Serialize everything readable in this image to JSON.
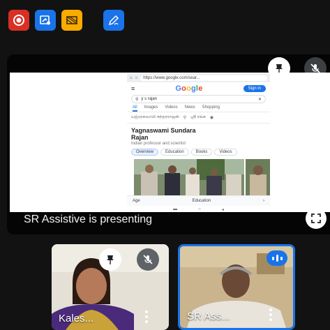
{
  "toolbar": {
    "buttons": [
      {
        "name": "record-icon",
        "color": "#d93025"
      },
      {
        "name": "whiteboard-share-icon",
        "color": "#1a73e8"
      },
      {
        "name": "no-video-icon",
        "color": "#f9ab00"
      },
      {
        "name": "annotate-pen-icon",
        "color": "#1a73e8"
      }
    ]
  },
  "stage": {
    "presenting_text": "SR Assistive is presenting",
    "shared_screen": {
      "url": "https://www.google.com/sear...",
      "logo": "Google",
      "signin": "Sign in",
      "query": "y s rajan",
      "tabs": [
        "All",
        "Images",
        "Videos",
        "News",
        "Shopping"
      ],
      "suggestion_left": "யஜ்ஞசுவாமி சுந்தரராஜன்",
      "suggestion_right": "ஸ்ரீ ரங்க",
      "kp_title": "Yagnaswami Sundara Rajan",
      "kp_subtitle": "Indian professor and scientist",
      "chips": [
        "Overview",
        "Education",
        "Books",
        "Videos"
      ],
      "row_left": "Age",
      "row_right": "Education"
    }
  },
  "participants": [
    {
      "name": "Kales...",
      "pinned": true,
      "muted": true
    },
    {
      "name": "SR Ass...",
      "speaking": true
    }
  ],
  "colors": {
    "accent": "#1a73e8",
    "background": "#121212"
  }
}
